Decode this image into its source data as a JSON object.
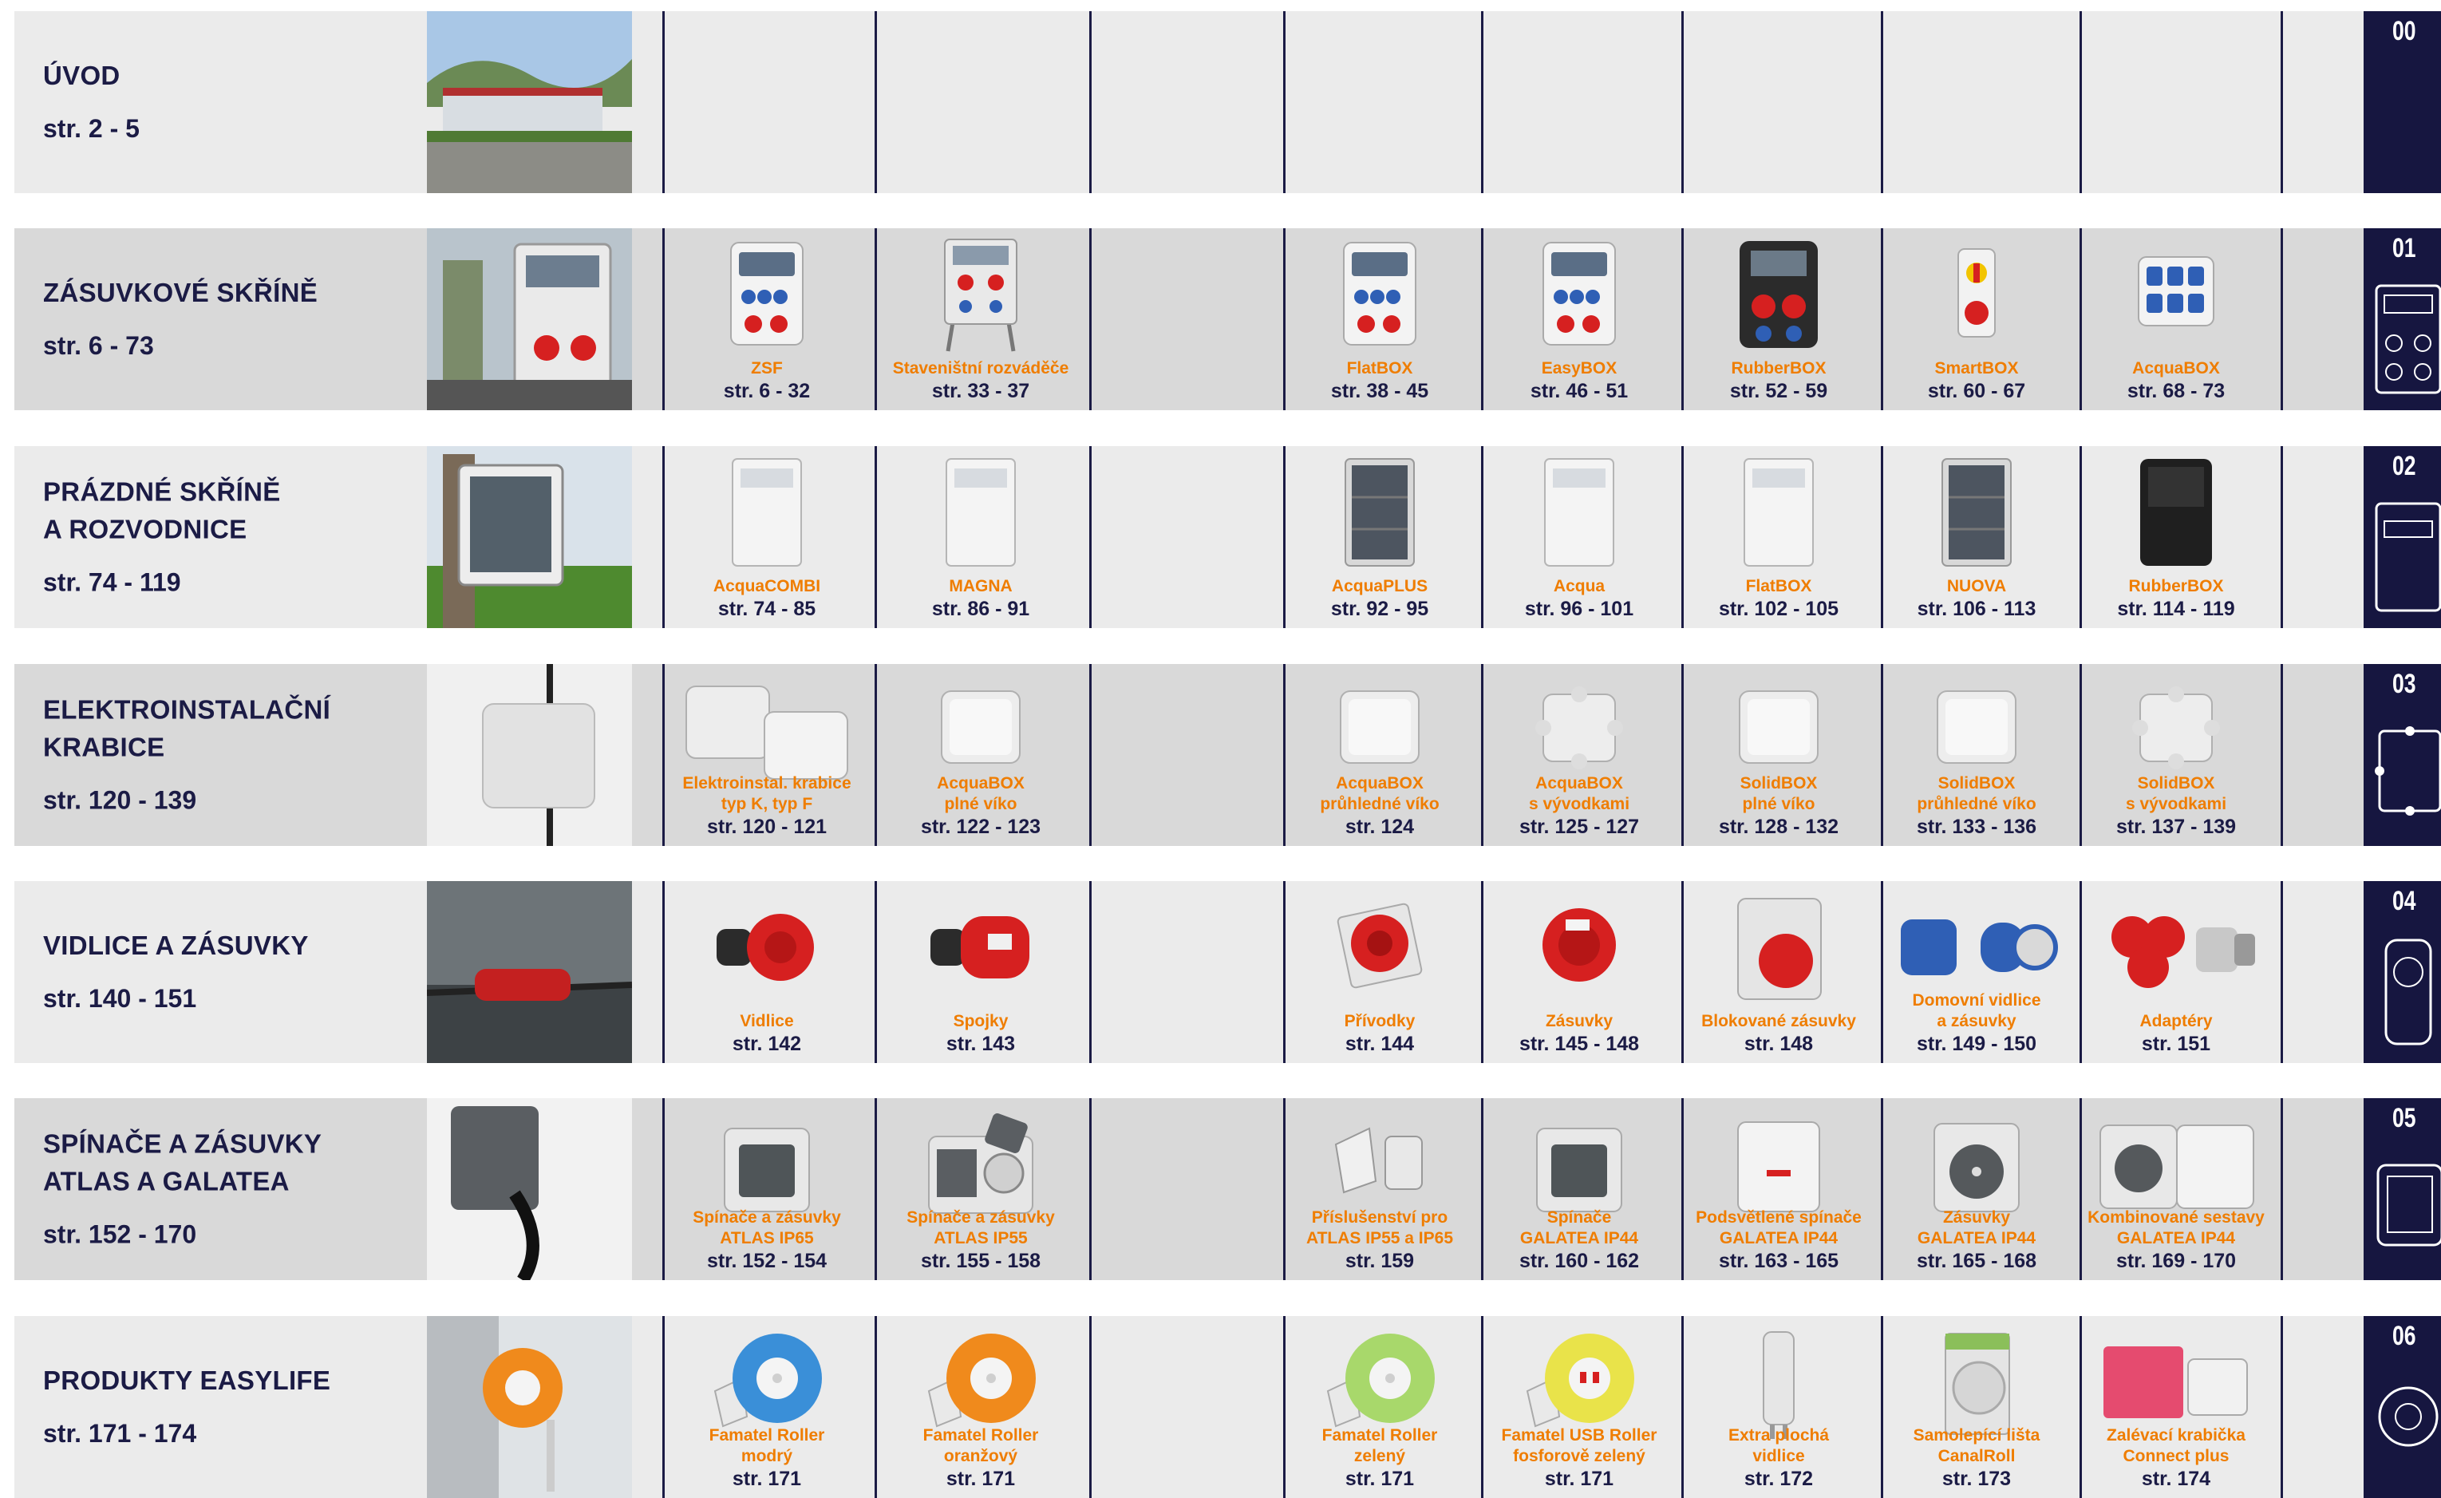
{
  "rows": [
    {
      "id": "00",
      "title": [
        "ÚVOD"
      ],
      "pages": "str. 2 - 5",
      "products": []
    },
    {
      "id": "01",
      "title": [
        "ZÁSUVKOVÉ SKŘÍNĚ"
      ],
      "pages": "str. 6 - 73",
      "products": [
        {
          "slot": 0,
          "name": [
            "ZSF"
          ],
          "pages": "str. 6 - 32",
          "icon": "socket-box-icon"
        },
        {
          "slot": 1,
          "name": [
            "Staveništní rozváděče"
          ],
          "pages": "str. 33 - 37",
          "icon": "site-distributor-icon"
        },
        {
          "slot": 3,
          "name": [
            "FlatBOX"
          ],
          "pages": "str. 38 - 45",
          "icon": "socket-box-icon"
        },
        {
          "slot": 4,
          "name": [
            "EasyBOX"
          ],
          "pages": "str. 46 - 51",
          "icon": "socket-box-icon"
        },
        {
          "slot": 5,
          "name": [
            "RubberBOX"
          ],
          "pages": "str. 52 - 59",
          "icon": "rubber-box-icon"
        },
        {
          "slot": 6,
          "name": [
            "SmartBOX"
          ],
          "pages": "str. 60 - 67",
          "icon": "smart-box-icon"
        },
        {
          "slot": 7,
          "name": [
            "AcquaBOX"
          ],
          "pages": "str. 68 - 73",
          "icon": "acqua-box-icon"
        }
      ]
    },
    {
      "id": "02",
      "title": [
        "PRÁZDNÉ SKŘÍNĚ",
        "A ROZVODNICE"
      ],
      "pages": "str. 74 - 119",
      "products": [
        {
          "slot": 0,
          "name": [
            "AcquaCOMBI"
          ],
          "pages": "str. 74 - 85",
          "icon": "enclosure-icon"
        },
        {
          "slot": 1,
          "name": [
            "MAGNA"
          ],
          "pages": "str. 86 - 91",
          "icon": "enclosure-icon"
        },
        {
          "slot": 3,
          "name": [
            "AcquaPLUS"
          ],
          "pages": "str. 92 - 95",
          "icon": "dark-enclosure-icon"
        },
        {
          "slot": 4,
          "name": [
            "Acqua"
          ],
          "pages": "str. 96 - 101",
          "icon": "enclosure-icon"
        },
        {
          "slot": 5,
          "name": [
            "FlatBOX"
          ],
          "pages": "str. 102 - 105",
          "icon": "enclosure-icon"
        },
        {
          "slot": 6,
          "name": [
            "NUOVA"
          ],
          "pages": "str. 106 - 113",
          "icon": "dark-enclosure-icon"
        },
        {
          "slot": 7,
          "name": [
            "RubberBOX"
          ],
          "pages": "str. 114 - 119",
          "icon": "black-enclosure-icon"
        }
      ]
    },
    {
      "id": "03",
      "title": [
        "ELEKTROINSTALAČNÍ",
        "KRABICE"
      ],
      "pages": "str. 120 - 139",
      "products": [
        {
          "slot": 0,
          "name": [
            "Elektroinstal. krabice",
            "typ K, typ F"
          ],
          "pages": "str. 120 - 121",
          "icon": "junction-box-pair-icon"
        },
        {
          "slot": 1,
          "name": [
            "AcquaBOX",
            "plné víko"
          ],
          "pages": "str. 122 - 123",
          "icon": "junction-box-icon"
        },
        {
          "slot": 3,
          "name": [
            "AcquaBOX",
            "průhledné víko"
          ],
          "pages": "str. 124",
          "icon": "junction-box-icon"
        },
        {
          "slot": 4,
          "name": [
            "AcquaBOX",
            "s vývodkami"
          ],
          "pages": "str. 125 - 127",
          "icon": "junction-box-glands-icon"
        },
        {
          "slot": 5,
          "name": [
            "SolidBOX",
            "plné víko"
          ],
          "pages": "str. 128 - 132",
          "icon": "junction-box-icon"
        },
        {
          "slot": 6,
          "name": [
            "SolidBOX",
            "průhledné víko"
          ],
          "pages": "str. 133 - 136",
          "icon": "junction-box-icon"
        },
        {
          "slot": 7,
          "name": [
            "SolidBOX",
            "s vývodkami"
          ],
          "pages": "str. 137 - 139",
          "icon": "junction-box-glands-icon"
        }
      ]
    },
    {
      "id": "04",
      "title": [
        "VIDLICE A ZÁSUVKY"
      ],
      "pages": "str. 140 - 151",
      "products": [
        {
          "slot": 0,
          "name": [
            "Vidlice"
          ],
          "pages": "str. 142",
          "icon": "plug-icon"
        },
        {
          "slot": 1,
          "name": [
            "Spojky"
          ],
          "pages": "str. 143",
          "icon": "coupler-icon"
        },
        {
          "slot": 3,
          "name": [
            "Přívodky"
          ],
          "pages": "str. 144",
          "icon": "inlet-icon"
        },
        {
          "slot": 4,
          "name": [
            "Zásuvky"
          ],
          "pages": "str. 145 - 148",
          "icon": "panel-socket-icon"
        },
        {
          "slot": 5,
          "name": [
            "Blokované zásuvky"
          ],
          "pages": "str. 148",
          "icon": "interlocked-socket-icon"
        },
        {
          "slot": 6,
          "name": [
            "Domovní vidlice",
            "a zásuvky"
          ],
          "pages": "str. 149 - 150",
          "icon": "blue-plug-icon"
        },
        {
          "slot": 7,
          "name": [
            "Adaptéry"
          ],
          "pages": "str. 151",
          "icon": "adapter-icon"
        }
      ]
    },
    {
      "id": "05",
      "title": [
        "SPÍNAČE A ZÁSUVKY",
        "ATLAS A GALATEA"
      ],
      "pages": "str. 152 - 170",
      "products": [
        {
          "slot": 0,
          "name": [
            "Spínače a zásuvky",
            "ATLAS IP65"
          ],
          "pages": "str. 152 - 154",
          "icon": "switch-icon"
        },
        {
          "slot": 1,
          "name": [
            "Spínače a zásuvky",
            "ATLAS IP55"
          ],
          "pages": "str. 155 - 158",
          "icon": "switch-socket-icon"
        },
        {
          "slot": 3,
          "name": [
            "Příslušenství pro",
            "ATLAS IP55 a IP65"
          ],
          "pages": "str. 159",
          "icon": "accessory-icon"
        },
        {
          "slot": 4,
          "name": [
            "Spínače",
            "GALATEA IP44"
          ],
          "pages": "str. 160 - 162",
          "icon": "switch-icon"
        },
        {
          "slot": 5,
          "name": [
            "Podsvětlené spínače",
            "GALATEA IP44"
          ],
          "pages": "str. 163 - 165",
          "icon": "lit-switch-icon"
        },
        {
          "slot": 6,
          "name": [
            "Zásuvky",
            "GALATEA IP44"
          ],
          "pages": "str. 165 - 168",
          "icon": "wall-socket-icon"
        },
        {
          "slot": 7,
          "name": [
            "Kombinované sestavy",
            "GALATEA IP44"
          ],
          "pages": "str. 169 - 170",
          "icon": "combo-icon"
        }
      ]
    },
    {
      "id": "06",
      "title": [
        "PRODUKTY EASYLIFE"
      ],
      "pages": "str. 171 - 174",
      "products": [
        {
          "slot": 0,
          "name": [
            "Famatel Roller",
            "modrý"
          ],
          "pages": "str. 171",
          "icon": "roller-blue-icon"
        },
        {
          "slot": 1,
          "name": [
            "Famatel Roller",
            "oranžový"
          ],
          "pages": "str. 171",
          "icon": "roller-orange-icon"
        },
        {
          "slot": 3,
          "name": [
            "Famatel Roller",
            "zelený"
          ],
          "pages": "str. 171",
          "icon": "roller-green-icon"
        },
        {
          "slot": 4,
          "name": [
            "Famatel USB Roller",
            "fosforově zelený"
          ],
          "pages": "str. 171",
          "icon": "roller-usb-icon"
        },
        {
          "slot": 5,
          "name": [
            "Extra plochá",
            "vidlice"
          ],
          "pages": "str. 172",
          "icon": "flat-plug-icon"
        },
        {
          "slot": 6,
          "name": [
            "Samolepící lišta",
            "CanalRoll"
          ],
          "pages": "str. 173",
          "icon": "canalroll-icon"
        },
        {
          "slot": 7,
          "name": [
            "Zalévací krabička",
            "Connect plus"
          ],
          "pages": "str. 174",
          "icon": "gel-box-icon"
        }
      ]
    }
  ],
  "colors": {
    "navy": "#1b1b45",
    "tab": "#161640",
    "orange": "#ef7d00",
    "row_light": "#ebebeb",
    "row_dark": "#d9d9d9"
  }
}
